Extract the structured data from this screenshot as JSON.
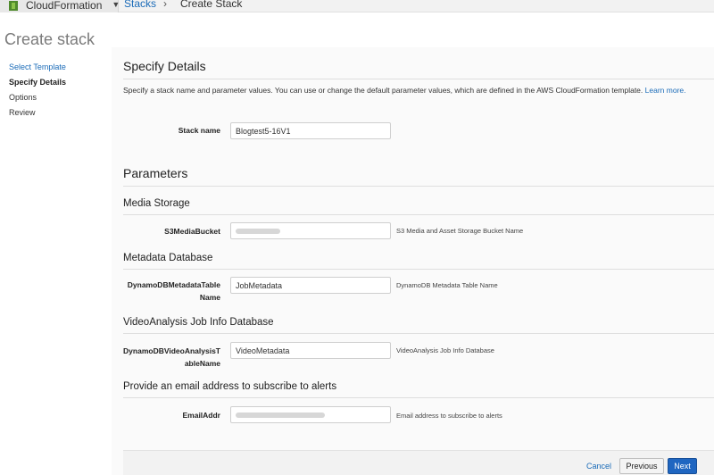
{
  "nav": {
    "service_name": "CloudFormation",
    "service_icon": "cloudformation-icon",
    "caret_icon": "chevron-down-icon",
    "breadcrumb_link": "Stacks",
    "breadcrumb_sep": "›",
    "breadcrumb_current": "Create Stack"
  },
  "page_title": "Create stack",
  "sidebar": {
    "items": [
      {
        "label": "Select Template"
      },
      {
        "label": "Specify Details"
      },
      {
        "label": "Options"
      },
      {
        "label": "Review"
      }
    ]
  },
  "details": {
    "title": "Specify Details",
    "description": "Specify a stack name and parameter values. You can use or change the default parameter values, which are defined in the AWS CloudFormation template.",
    "learn_more": "Learn more.",
    "stack_name_label": "Stack name",
    "stack_name_value": "Blogtest5-16V1"
  },
  "parameters": {
    "title": "Parameters",
    "groups": [
      {
        "title": "Media Storage",
        "label_1": "S3MediaBucket",
        "label_2": "",
        "value": "",
        "hint": "S3 Media and Asset Storage Bucket Name"
      },
      {
        "title": "Metadata Database",
        "label_1": "DynamoDBMetadataTable",
        "label_2": "Name",
        "value": "JobMetadata",
        "hint": "DynamoDB Metadata Table Name"
      },
      {
        "title": "VideoAnalysis Job Info Database",
        "label_1": "DynamoDBVideoAnalysisT",
        "label_2": "ableName",
        "value": "VideoMetadata",
        "hint": "VideoAnalysis Job Info Database"
      },
      {
        "title": "Provide an email address to subscribe to alerts",
        "label_1": "EmailAddr",
        "label_2": "",
        "value": "",
        "hint": "Email address to subscribe to alerts"
      }
    ]
  },
  "footer": {
    "cancel": "Cancel",
    "previous": "Previous",
    "next": "Next"
  },
  "colors": {
    "link": "#1a6bb8",
    "primary_button": "#1f66c1"
  }
}
